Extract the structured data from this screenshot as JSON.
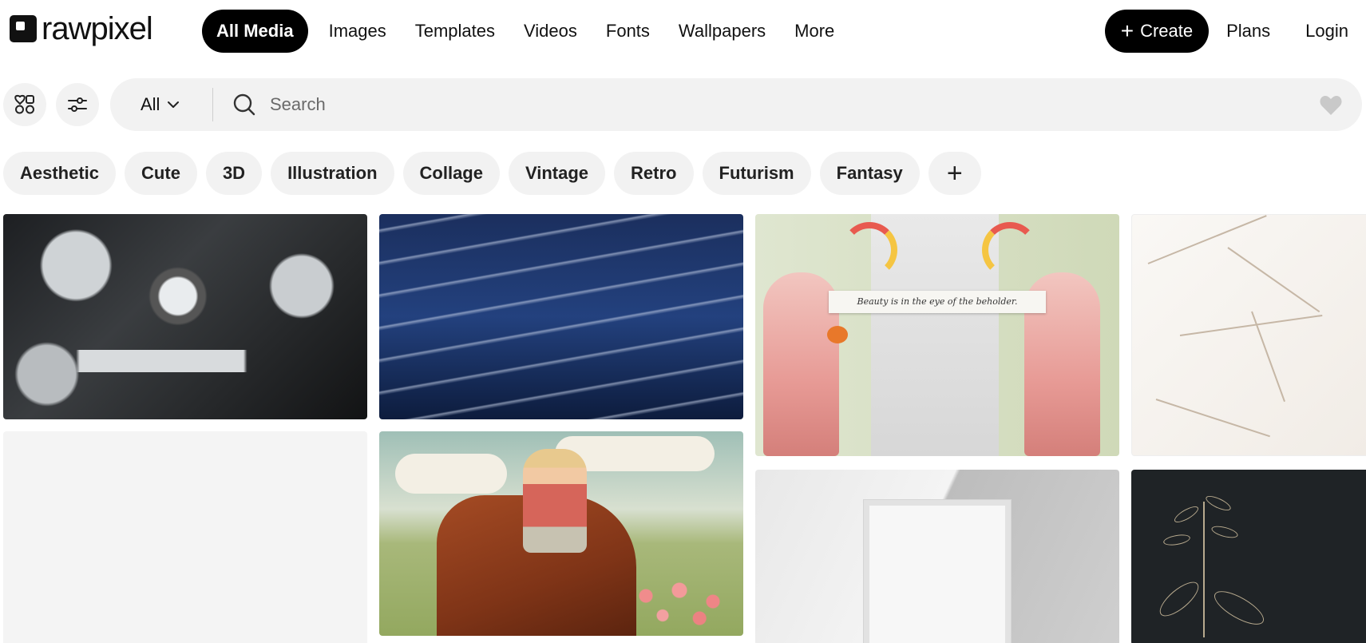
{
  "header": {
    "logo_text": "rawpixel",
    "nav": [
      {
        "label": "All Media",
        "active": true
      },
      {
        "label": "Images"
      },
      {
        "label": "Templates"
      },
      {
        "label": "Videos"
      },
      {
        "label": "Fonts"
      },
      {
        "label": "Wallpapers"
      },
      {
        "label": "More"
      }
    ],
    "create_label": "Create",
    "plans_label": "Plans",
    "login_label": "Login"
  },
  "search": {
    "scope": "All",
    "placeholder": "Search"
  },
  "chips": [
    "Aesthetic",
    "Cute",
    "3D",
    "Illustration",
    "Collage",
    "Vintage",
    "Retro",
    "Futurism",
    "Fantasy"
  ],
  "grid": {
    "collage_quote": "Beauty is in the eye of the beholder."
  },
  "icons": {
    "favorites": "favorites-grid-icon",
    "filter": "filter-sliders-icon",
    "search": "search-icon",
    "heart": "heart-icon",
    "scope_caret": "chevron-down-icon",
    "add_chip": "plus-icon"
  },
  "colors": {
    "primary": "#000000",
    "surface": "#f2f2f2",
    "text": "#111111"
  }
}
